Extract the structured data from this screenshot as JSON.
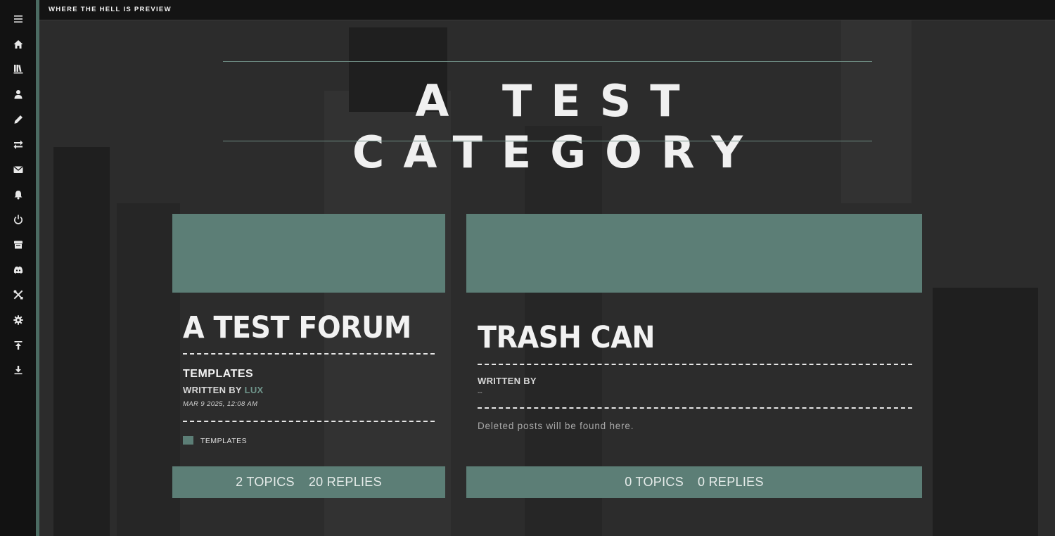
{
  "topbar": {
    "title": "WHERE THE HELL IS PREVIEW"
  },
  "sidebar": {
    "icons": [
      "menu-icon",
      "home-icon",
      "library-icon",
      "user-icon",
      "pencil-icon",
      "swap-icon",
      "mail-icon",
      "bell-icon",
      "power-icon",
      "store-icon",
      "discord-icon",
      "tools-icon",
      "gear-icon",
      "upload-icon",
      "download-icon"
    ]
  },
  "category": {
    "title": "A TEST CATEGORY"
  },
  "forums": [
    {
      "name": "A TEST FORUM",
      "last_post_title": "TEMPLATES",
      "written_by_label": "WRITTEN BY",
      "author": "LUX",
      "date": "MAR 9 2025, 12:08 AM",
      "subforum": "TEMPLATES",
      "topics": "2 TOPICS",
      "replies": "20 REPLIES"
    },
    {
      "name": "TRASH CAN",
      "written_by_label": "WRITTEN BY",
      "author_placeholder": "--",
      "description": "Deleted posts will be found here.",
      "topics": "0 TOPICS",
      "replies": "0 REPLIES"
    }
  ],
  "colors": {
    "accent": "#5c7e76",
    "sidebar_accent": "#4b6b62",
    "background": "#2c2c2c"
  }
}
